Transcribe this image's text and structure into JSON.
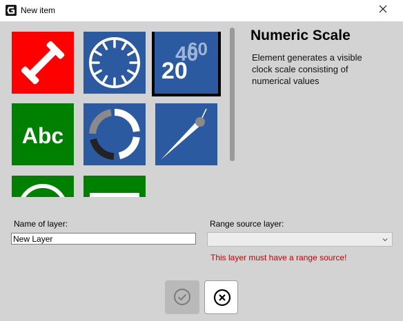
{
  "window": {
    "title": "New item",
    "app_icon": "app-logo-icon",
    "close_icon": "close-icon"
  },
  "gallery": {
    "tiles": [
      {
        "name": "tile-ruler",
        "icon": "ruler-icon",
        "color": "#ff0000"
      },
      {
        "name": "tile-clock-scale",
        "icon": "clock-scale-icon",
        "color": "#2c5aa0"
      },
      {
        "name": "tile-numeric-scale",
        "icon": "numeric-scale-icon",
        "color": "#2c5aa0",
        "selected": true,
        "label_a": "20",
        "label_b": "40",
        "label_c": "60"
      },
      {
        "name": "tile-text",
        "icon": "text-icon",
        "color": "#008000",
        "label": "Abc"
      },
      {
        "name": "tile-ring-segments",
        "icon": "ring-segments-icon",
        "color": "#2c5aa0"
      },
      {
        "name": "tile-needle",
        "icon": "needle-icon",
        "color": "#2c5aa0"
      },
      {
        "name": "tile-circle",
        "icon": "circle-icon",
        "color": "#008000"
      },
      {
        "name": "tile-rectangle",
        "icon": "rectangle-icon",
        "color": "#008000"
      }
    ]
  },
  "description": {
    "title": "Numeric Scale",
    "text": "Element generates a visible clock scale consisting of numerical values"
  },
  "form": {
    "name_label": "Name of layer:",
    "name_value": "New Layer",
    "range_label": "Range source layer:",
    "range_value": "",
    "error": "This layer must have a range source!"
  },
  "buttons": {
    "ok_icon": "checkmark-icon",
    "cancel_icon": "cancel-x-icon"
  },
  "colors": {
    "error": "#c40000",
    "tile_blue": "#2c5aa0",
    "tile_green": "#008000",
    "tile_red": "#ff0000"
  }
}
